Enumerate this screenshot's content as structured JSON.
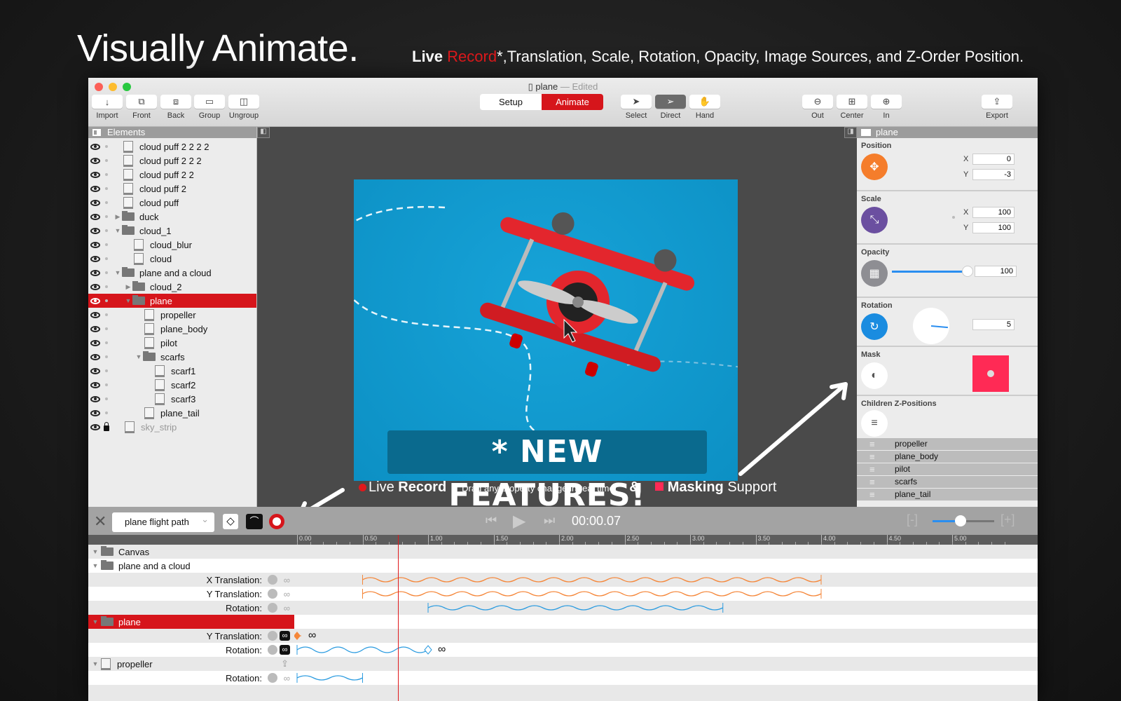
{
  "promo": {
    "headline": "Visually Animate.",
    "tagline_live": "Live",
    "tagline_record": "Record",
    "tagline_rest": "*,Translation, Scale, Rotation, Opacity, Image Sources, and Z-Order Position.",
    "accent": "#e0191c"
  },
  "window": {
    "doc_name": "plane",
    "doc_state": "— Edited"
  },
  "toolbar": {
    "left": [
      {
        "label": "Import",
        "icon": "↓"
      },
      {
        "label": "Front",
        "icon": "⧉"
      },
      {
        "label": "Back",
        "icon": "⧈"
      },
      {
        "label": "Group",
        "icon": "▭"
      },
      {
        "label": "Ungroup",
        "icon": "◫"
      }
    ],
    "mode_setup": "Setup",
    "mode_animate": "Animate",
    "tools": [
      {
        "label": "Select",
        "icon": "➤"
      },
      {
        "label": "Direct",
        "icon": "➢"
      },
      {
        "label": "Hand",
        "icon": "✋"
      }
    ],
    "zoom": [
      {
        "label": "Out",
        "icon": "⊖"
      },
      {
        "label": "Center",
        "icon": "⊞"
      },
      {
        "label": "In",
        "icon": "⊕"
      }
    ],
    "export": {
      "label": "Export",
      "icon": "⇪"
    }
  },
  "elements": {
    "title": "Elements",
    "items": [
      {
        "name": "cloud puff 2 2 2 2",
        "type": "file",
        "depth": 0
      },
      {
        "name": "cloud puff 2 2 2",
        "type": "file",
        "depth": 0
      },
      {
        "name": "cloud puff 2 2",
        "type": "file",
        "depth": 0
      },
      {
        "name": "cloud puff 2",
        "type": "file",
        "depth": 0
      },
      {
        "name": "cloud puff",
        "type": "file",
        "depth": 0
      },
      {
        "name": "duck",
        "type": "folder",
        "depth": 0,
        "expanded": false
      },
      {
        "name": "cloud_1",
        "type": "folder",
        "depth": 0,
        "expanded": true
      },
      {
        "name": "cloud_blur",
        "type": "file",
        "depth": 1
      },
      {
        "name": "cloud",
        "type": "file",
        "depth": 1
      },
      {
        "name": "plane and a cloud",
        "type": "folder",
        "depth": 0,
        "expanded": true
      },
      {
        "name": "cloud_2",
        "type": "folder",
        "depth": 1,
        "expanded": false
      },
      {
        "name": "plane",
        "type": "folder",
        "depth": 1,
        "expanded": true,
        "selected": true
      },
      {
        "name": "propeller",
        "type": "file",
        "depth": 2
      },
      {
        "name": "plane_body",
        "type": "file",
        "depth": 2
      },
      {
        "name": "pilot",
        "type": "file",
        "depth": 2
      },
      {
        "name": "scarfs",
        "type": "folder",
        "depth": 2,
        "expanded": true
      },
      {
        "name": "scarf1",
        "type": "file",
        "depth": 3
      },
      {
        "name": "scarf2",
        "type": "file",
        "depth": 3
      },
      {
        "name": "scarf3",
        "type": "file",
        "depth": 3
      },
      {
        "name": "plane_tail",
        "type": "file",
        "depth": 2
      },
      {
        "name": "sky_strip",
        "type": "file",
        "depth": 0,
        "locked": true,
        "dim": true
      }
    ]
  },
  "canvas": {
    "banner": "* NEW FEATURES!",
    "cap_live": "Live",
    "cap_record": "Record",
    "cap_desc": "Drag any property change in real time!",
    "cap_amp": "&",
    "cap_mask": "Masking",
    "cap_support": "Support"
  },
  "inspector": {
    "title": "plane",
    "position": {
      "label": "Position",
      "x": "0",
      "y": "-3",
      "color": "#f57d2b"
    },
    "scale": {
      "label": "Scale",
      "x": "100",
      "y": "100",
      "color": "#6b4fa0"
    },
    "opacity": {
      "label": "Opacity",
      "value": "100",
      "fraction": 1.0,
      "color": "#8e8e93"
    },
    "rotation": {
      "label": "Rotation",
      "value": "5",
      "color": "#1a8ce0"
    },
    "mask": {
      "label": "Mask",
      "color": "#ff2a55"
    },
    "children": {
      "label": "Children Z-Positions",
      "items": [
        "propeller",
        "plane_body",
        "pilot",
        "scarfs",
        "plane_tail"
      ]
    },
    "axis_x": "X",
    "axis_y": "Y"
  },
  "timeline": {
    "animation": "plane flight path",
    "time": "00:00.07",
    "zoom_fraction": 0.45,
    "ruler": [
      "0.00",
      "0.50",
      "1.00",
      "1.50",
      "2.00",
      "2.50",
      "3.00",
      "3.50",
      "4.00",
      "4.50",
      "5.00"
    ],
    "rows": [
      {
        "kind": "group",
        "name": "Canvas",
        "icon": "folder"
      },
      {
        "kind": "group",
        "name": "plane and a cloud",
        "icon": "folder"
      },
      {
        "kind": "prop",
        "name": "X Translation:",
        "start": 0.5,
        "end": 4.0,
        "color": "#f5873a",
        "loop": false
      },
      {
        "kind": "prop",
        "name": "Y Translation:",
        "start": 0.5,
        "end": 4.0,
        "color": "#f5873a",
        "loop": false
      },
      {
        "kind": "prop",
        "name": "Rotation:",
        "start": 1.0,
        "end": 3.25,
        "color": "#2a9be0",
        "loop": false
      },
      {
        "kind": "group",
        "name": "plane",
        "icon": "folder",
        "selected": true
      },
      {
        "kind": "prop",
        "name": "Y Translation:",
        "start": 0.0,
        "end": 0.0,
        "color": "#f5873a",
        "loop": true
      },
      {
        "kind": "prop",
        "name": "Rotation:",
        "start": 0.0,
        "end": 1.0,
        "color": "#2a9be0",
        "loop": true
      },
      {
        "kind": "group",
        "name": "propeller",
        "icon": "file"
      },
      {
        "kind": "prop",
        "name": "Rotation:",
        "start": 0.0,
        "end": 0.5,
        "color": "#2a9be0",
        "loop": false
      }
    ]
  }
}
